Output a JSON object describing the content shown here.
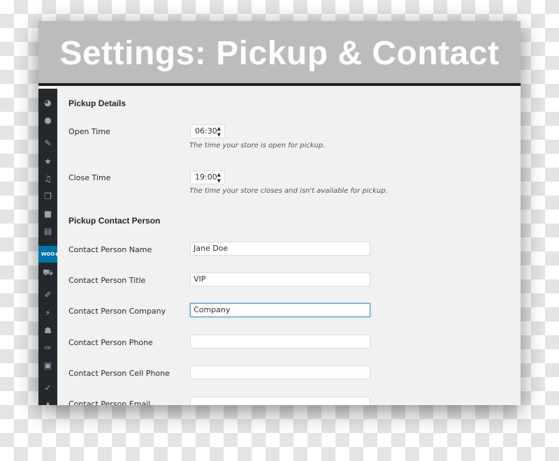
{
  "title": "Settings: Pickup & Contact",
  "sidebar": {
    "icons": [
      "dashboard-icon",
      "jetpack-icon",
      "pin-icon",
      "star-icon",
      "media-icon",
      "pages-icon",
      "comments-icon",
      "forms-icon",
      "woocommerce-icon",
      "cart-icon",
      "appearance-icon",
      "plugins-icon",
      "users-icon",
      "tools-icon",
      "settings-icon",
      "yoast-icon",
      "more-icon"
    ],
    "active": "woocommerce-icon",
    "active_label": "WOO"
  },
  "pickup_details": {
    "heading": "Pickup Details",
    "open_time": {
      "label": "Open Time",
      "value": "06:30",
      "description": "The time your store is open for pickup."
    },
    "close_time": {
      "label": "Close Time",
      "value": "19:00",
      "description": "The time your store closes and isn't available for pickup."
    }
  },
  "contact": {
    "heading": "Pickup Contact Person",
    "fields": [
      {
        "label": "Contact Person Name",
        "value": "Jane Doe"
      },
      {
        "label": "Contact Person Title",
        "value": "VIP"
      },
      {
        "label": "Contact Person Company",
        "value": "Company"
      },
      {
        "label": "Contact Person Phone",
        "value": ""
      },
      {
        "label": "Contact Person Cell Phone",
        "value": ""
      },
      {
        "label": "Contact Person Email",
        "value": ""
      }
    ]
  },
  "colors": {
    "accent": "#0073aa",
    "sidebar": "#23282d",
    "header": "#bcbcbc"
  }
}
